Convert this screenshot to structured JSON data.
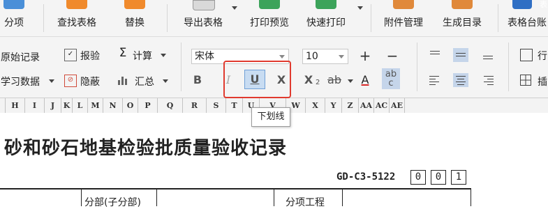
{
  "toolbar_top": {
    "items": [
      {
        "label": "分项"
      },
      {
        "label": "查找表格"
      },
      {
        "label": "替换"
      },
      {
        "label": "导出表格"
      },
      {
        "label": "打印预览"
      },
      {
        "label": "快速打印"
      },
      {
        "label": "附件管理"
      },
      {
        "label": "生成目录"
      },
      {
        "label": "表格台账"
      }
    ],
    "partial_label": "表"
  },
  "toolbar_second": {
    "raw_record": "原始记录",
    "study_data": "学习数据",
    "check": "报验",
    "hide": "隐蔽",
    "calc": "计算",
    "summary": "汇总",
    "font_name": "宋体",
    "font_size": "10",
    "increase_size": "+",
    "decrease_size": "−",
    "bold": "B",
    "italic": "I",
    "underline": "U",
    "clear_format": "X",
    "subscript": "X",
    "subscript_small": "2",
    "strikethrough": "ab",
    "font_color": "A",
    "wrap_text": "ab c",
    "row_label": "行",
    "insert_label": "插"
  },
  "column_headers": [
    "H",
    "I",
    "J",
    "K",
    "L",
    "M",
    "N",
    "O",
    "P",
    "Q",
    "R",
    "S",
    "T",
    "U",
    "V",
    "W",
    "X",
    "Y",
    "Z",
    "AA",
    "AC",
    "AE"
  ],
  "tooltip": "下划线",
  "document": {
    "title": "砂和砂石地基检验批质量验收记录",
    "code": "GD-C3-5122",
    "number_boxes": [
      "0",
      "0",
      "1"
    ],
    "row_labels": [
      "分部(子分部)",
      "分项工程"
    ]
  },
  "colors": {
    "highlight": "#e03a2e",
    "selected_align": "#c5d5ea",
    "underline_blue": "#1f6fd1"
  }
}
